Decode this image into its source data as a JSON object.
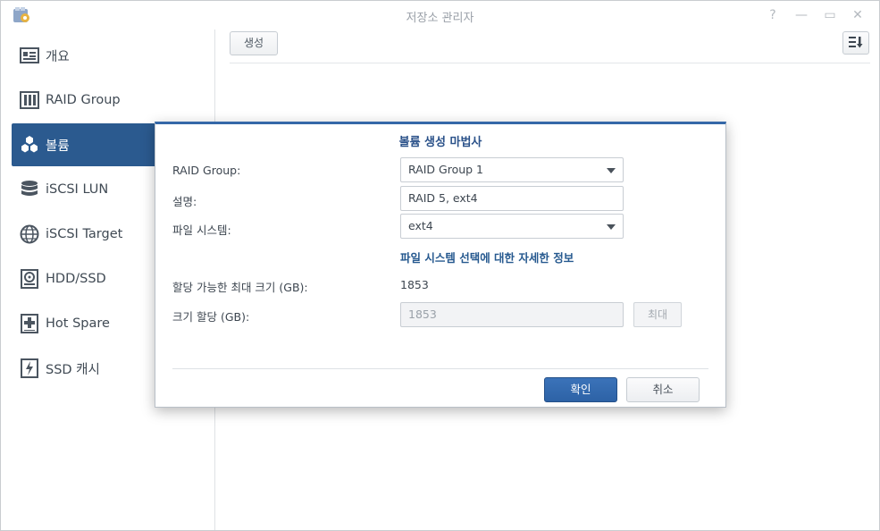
{
  "window": {
    "title": "저장소 관리자",
    "controls": {
      "help": "?",
      "minimize": "—",
      "maximize": "▭",
      "close": "✕"
    }
  },
  "sidebar": {
    "items": [
      {
        "label": "개요",
        "icon": "overview-icon",
        "active": false
      },
      {
        "label": "RAID Group",
        "icon": "raid-group-icon",
        "active": false
      },
      {
        "label": "볼륨",
        "icon": "volume-cubes-icon",
        "active": true
      },
      {
        "label": "iSCSI LUN",
        "icon": "database-icon",
        "active": false
      },
      {
        "label": "iSCSI Target",
        "icon": "globe-icon",
        "active": false
      },
      {
        "label": "HDD/SSD",
        "icon": "disk-icon",
        "active": false
      },
      {
        "label": "Hot Spare",
        "icon": "hot-spare-plus-icon",
        "active": false
      },
      {
        "label": "SSD 캐시",
        "icon": "ssd-cache-bolt-icon",
        "active": false
      }
    ]
  },
  "toolbar": {
    "create_label": "생성",
    "sort_icon": "sort-icon"
  },
  "dialog": {
    "title": "볼륨 생성 마법사",
    "raid_group": {
      "label": "RAID Group:",
      "value": "RAID Group 1"
    },
    "description": {
      "label": "설명:",
      "value": "RAID 5, ext4"
    },
    "filesystem": {
      "label": "파일 시스템:",
      "value": "ext4"
    },
    "filesystem_info_link": "파일 시스템 선택에 대한 자세한 정보",
    "max_size": {
      "label": "할당 가능한 최대 크기 (GB):",
      "value": "1853"
    },
    "alloc_size": {
      "label": "크기 할당 (GB):",
      "value": "1853"
    },
    "max_button": "최대",
    "ok_button": "확인",
    "cancel_button": "취소"
  },
  "colors": {
    "accent": "#2b5a8f",
    "dialog_title": "#2a5189",
    "link": "#26598f",
    "primary_button": "#2d62a6"
  }
}
